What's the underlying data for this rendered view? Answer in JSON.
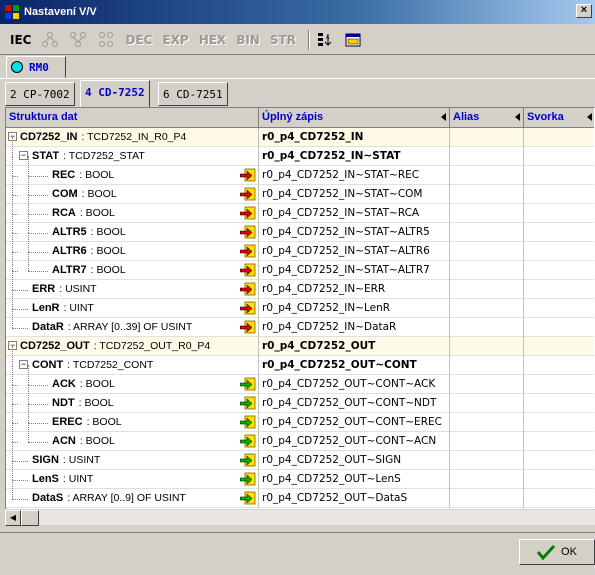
{
  "window": {
    "title": "Nastavení V/V"
  },
  "toolbar": {
    "iec": "IEC",
    "dec": "DEC",
    "exp": "EXP",
    "hex": "HEX",
    "bin": "BIN",
    "str": "STR"
  },
  "station_tab": {
    "label": "RM0"
  },
  "module_tabs": [
    {
      "label": "2 CP-7002",
      "active": false
    },
    {
      "label": "4 CD-7252",
      "active": true
    },
    {
      "label": "6 CD-7251",
      "active": false
    }
  ],
  "columns": [
    "Struktura dat",
    "Úplný zápis",
    "Alias",
    "Svorka"
  ],
  "rows": [
    {
      "name": "CD7252_IN",
      "type": ": TCD7252_IN_R0_P4",
      "full": "r0_p4_CD7252_IN",
      "level": 0,
      "toggle": "-",
      "arrow": "",
      "highlight": true
    },
    {
      "name": "STAT",
      "type": ": TCD7252_STAT",
      "full": "r0_p4_CD7252_IN~STAT",
      "level": 1,
      "toggle": "-",
      "arrow": "",
      "highlight": false
    },
    {
      "name": "REC",
      "type": ": BOOL",
      "full": "r0_p4_CD7252_IN~STAT~REC",
      "level": 2,
      "toggle": "",
      "arrow": "in",
      "highlight": false
    },
    {
      "name": "COM",
      "type": ": BOOL",
      "full": "r0_p4_CD7252_IN~STAT~COM",
      "level": 2,
      "toggle": "",
      "arrow": "in",
      "highlight": false
    },
    {
      "name": "RCA",
      "type": ": BOOL",
      "full": "r0_p4_CD7252_IN~STAT~RCA",
      "level": 2,
      "toggle": "",
      "arrow": "in",
      "highlight": false
    },
    {
      "name": "ALTR5",
      "type": ": BOOL",
      "full": "r0_p4_CD7252_IN~STAT~ALTR5",
      "level": 2,
      "toggle": "",
      "arrow": "in",
      "highlight": false
    },
    {
      "name": "ALTR6",
      "type": ": BOOL",
      "full": "r0_p4_CD7252_IN~STAT~ALTR6",
      "level": 2,
      "toggle": "",
      "arrow": "in",
      "highlight": false
    },
    {
      "name": "ALTR7",
      "type": ": BOOL",
      "full": "r0_p4_CD7252_IN~STAT~ALTR7",
      "level": 2,
      "toggle": "",
      "arrow": "in",
      "highlight": false
    },
    {
      "name": "ERR",
      "type": ": USINT",
      "full": "r0_p4_CD7252_IN~ERR",
      "level": 1,
      "toggle": "",
      "arrow": "in",
      "highlight": false
    },
    {
      "name": "LenR",
      "type": ": UINT",
      "full": "r0_p4_CD7252_IN~LenR",
      "level": 1,
      "toggle": "",
      "arrow": "in",
      "highlight": false
    },
    {
      "name": "DataR",
      "type": ": ARRAY [0..39] OF USINT",
      "full": "r0_p4_CD7252_IN~DataR",
      "level": 1,
      "toggle": "",
      "arrow": "in",
      "highlight": false
    },
    {
      "name": "CD7252_OUT",
      "type": ": TCD7252_OUT_R0_P4",
      "full": "r0_p4_CD7252_OUT",
      "level": 0,
      "toggle": "-",
      "arrow": "",
      "highlight": true
    },
    {
      "name": "CONT",
      "type": ": TCD7252_CONT",
      "full": "r0_p4_CD7252_OUT~CONT",
      "level": 1,
      "toggle": "-",
      "arrow": "",
      "highlight": false
    },
    {
      "name": "ACK",
      "type": ": BOOL",
      "full": "r0_p4_CD7252_OUT~CONT~ACK",
      "level": 2,
      "toggle": "",
      "arrow": "out",
      "highlight": false
    },
    {
      "name": "NDT",
      "type": ": BOOL",
      "full": "r0_p4_CD7252_OUT~CONT~NDT",
      "level": 2,
      "toggle": "",
      "arrow": "out",
      "highlight": false
    },
    {
      "name": "EREC",
      "type": ": BOOL",
      "full": "r0_p4_CD7252_OUT~CONT~EREC",
      "level": 2,
      "toggle": "",
      "arrow": "out",
      "highlight": false
    },
    {
      "name": "ACN",
      "type": ": BOOL",
      "full": "r0_p4_CD7252_OUT~CONT~ACN",
      "level": 2,
      "toggle": "",
      "arrow": "out",
      "highlight": false
    },
    {
      "name": "SIGN",
      "type": ": USINT",
      "full": "r0_p4_CD7252_OUT~SIGN",
      "level": 1,
      "toggle": "",
      "arrow": "out",
      "highlight": false
    },
    {
      "name": "LenS",
      "type": ": UINT",
      "full": "r0_p4_CD7252_OUT~LenS",
      "level": 1,
      "toggle": "",
      "arrow": "out",
      "highlight": false
    },
    {
      "name": "DataS",
      "type": ": ARRAY [0..9] OF USINT",
      "full": "r0_p4_CD7252_OUT~DataS",
      "level": 1,
      "toggle": "",
      "arrow": "out",
      "highlight": false
    }
  ],
  "buttons": {
    "ok": "OK"
  },
  "colors": {
    "title_bar": "#0a246a",
    "header_text": "#0000cc",
    "station_dot": "#00e0f0",
    "arrow_in": "#e00000",
    "arrow_out": "#00b000",
    "arrow_box": "#ffe000"
  }
}
